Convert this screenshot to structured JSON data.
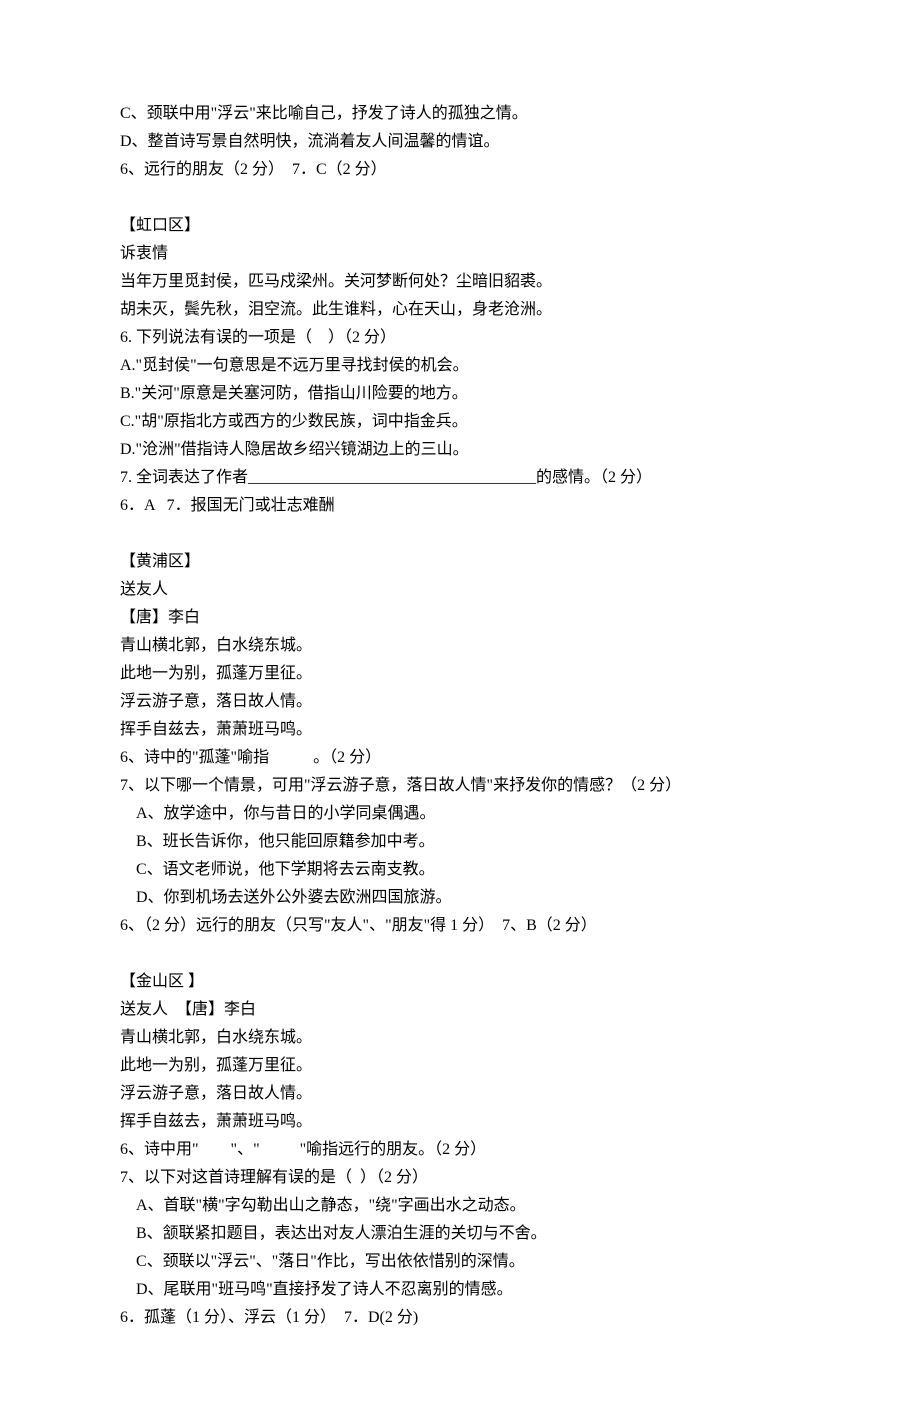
{
  "intro": {
    "l1": "C、颈联中用\"浮云\"来比喻自己，抒发了诗人的孤独之情。",
    "l2": "D、整首诗写景自然明快，流淌着友人间温馨的情谊。",
    "l3": "6、远行的朋友（2 分）  7．C（2 分）"
  },
  "hongkou": {
    "title": "【虹口区】",
    "ptitle": "诉衷情",
    "p1": "当年万里觅封侯，匹马戍梁州。关河梦断何处？尘暗旧貂裘。",
    "p2": "胡未灭，鬓先秋，泪空流。此生谁料，心在天山，身老沧洲。",
    "q6": "6. 下列说法有误的一项是（    ）（2 分）",
    "a": "A.\"觅封侯\"一句意思是不远万里寻找封侯的机会。",
    "b": "B.\"关河\"原意是关塞河防，借指山川险要的地方。",
    "c": "C.\"胡\"原指北方或西方的少数民族，词中指金兵。",
    "d": "D.\"沧洲\"借指诗人隐居故乡绍兴镜湖边上的三山。",
    "q7": "7. 全词表达了作者____________________________________的感情。（2 分）",
    "ans": "6．A   7．报国无门或壮志难酬"
  },
  "huangpu": {
    "title": "【黄浦区】",
    "ptitle": "送友人",
    "author": "【唐】李白",
    "p1": "青山横北郭，白水绕东城。",
    "p2": "此地一为别，孤蓬万里征。",
    "p3": "浮云游子意，落日故人情。",
    "p4": "挥手自兹去，萧萧班马鸣。",
    "q6": "6、诗中的\"孤蓬\"喻指           。（2 分）",
    "q7": "7、以下哪一个情景，可用\"浮云游子意，落日故人情\"来抒发你的情感？（2 分）",
    "a": "A、放学途中，你与昔日的小学同桌偶遇。",
    "b": "B、班长告诉你，他只能回原籍参加中考。",
    "c": "C、语文老师说，他下学期将去云南支教。",
    "d": "D、你到机场去送外公外婆去欧洲四国旅游。",
    "ans": "6、（2 分）远行的朋友（只写\"友人\"、\"朋友\"得 1 分）  7、B（2 分）"
  },
  "jinshan": {
    "title": "【金山区 】",
    "ptitle": "送友人  【唐】李白",
    "p1": "青山横北郭，白水绕东城。",
    "p2": "此地一为别，孤蓬万里征。",
    "p3": "浮云游子意，落日故人情。",
    "p4": "挥手自兹去，萧萧班马鸣。",
    "q6": "6、诗中用\"        \"、\"          \"喻指远行的朋友。（2 分）",
    "q7": "7、以下对这首诗理解有误的是（  ）（2 分）",
    "a": "A、首联\"横\"字勾勒出山之静态，\"绕\"字画出水之动态。",
    "b": "B、颔联紧扣题目，表达出对友人漂泊生涯的关切与不舍。",
    "c": "C、颈联以\"浮云\"、\"落日\"作比，写出依依惜别的深情。",
    "d": "D、尾联用\"班马鸣\"直接抒发了诗人不忍离别的情感。",
    "ans": "6．孤蓬（1 分）、浮云（1 分）  7．D(2 分)"
  }
}
